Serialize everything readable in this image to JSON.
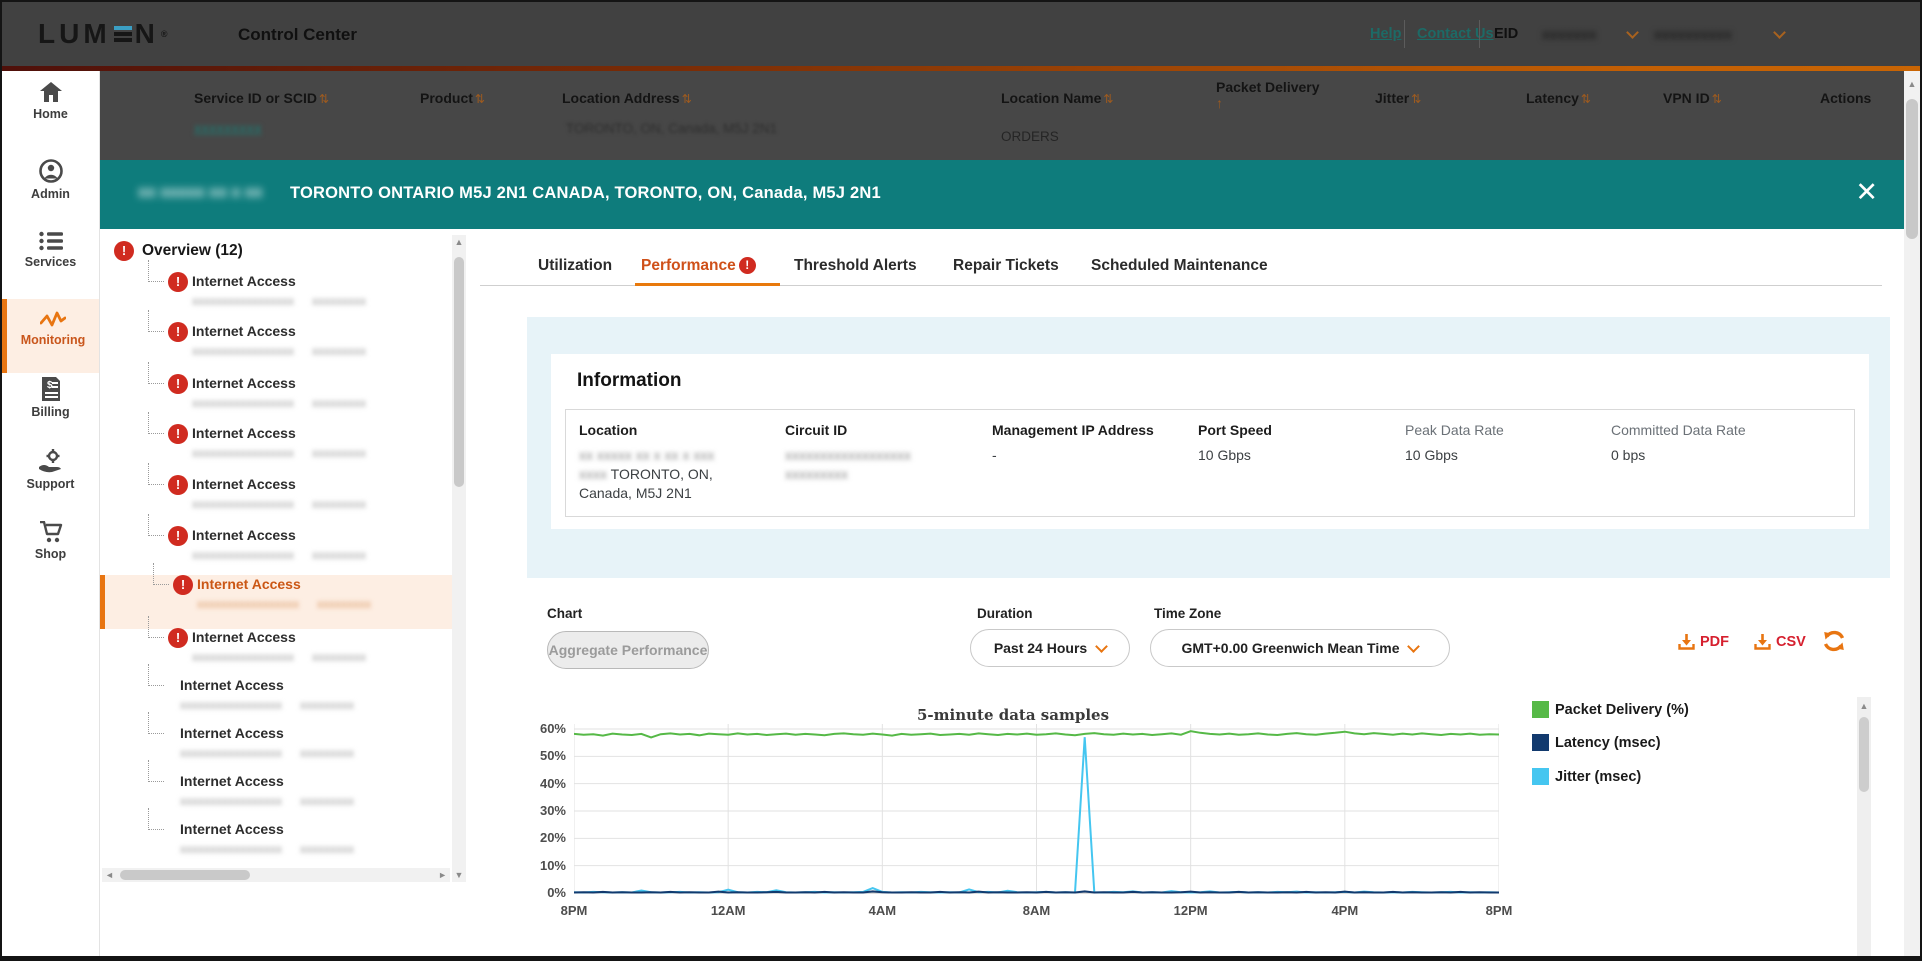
{
  "header": {
    "logo": "LUM·N",
    "logo_registered": "®",
    "app_title": "Control Center",
    "help_link": "Help",
    "contact_link": "Contact Us",
    "eid_label": "EID",
    "eid_value_masked": "xxxxxxx",
    "account_value_masked": "xxxxxxxxxx"
  },
  "table": {
    "columns": [
      {
        "label": "Service ID or SCID",
        "sort_glyph": "⇅"
      },
      {
        "label": "Product",
        "sort_glyph": "⇅"
      },
      {
        "label": "Location Address",
        "sort_glyph": "⇅"
      },
      {
        "label": "Location Name",
        "sort_glyph": "⇅"
      },
      {
        "label": "Packet Delivery",
        "sort_glyph": "↑"
      },
      {
        "label": "Jitter",
        "sort_glyph": "⇅"
      },
      {
        "label": "Latency",
        "sort_glyph": "⇅"
      },
      {
        "label": "VPN ID",
        "sort_glyph": "⇅"
      },
      {
        "label": "Actions",
        "sort_glyph": ""
      }
    ],
    "partial_row": {
      "service_id_masked": "xxxxxxxxx",
      "location_address_partial": "TORONTO, ON, Canada, M5J 2N1",
      "location_name": "ORDERS"
    }
  },
  "banner": {
    "masked_prefix": "xx xxxxx xx x xx",
    "address": "TORONTO ONTARIO M5J 2N1 CANADA, TORONTO, ON, Canada, M5J 2N1",
    "close_glyph": "✕"
  },
  "sidebar": {
    "items": [
      {
        "label": "Home"
      },
      {
        "label": "Admin"
      },
      {
        "label": "Services"
      },
      {
        "label": "Monitoring",
        "active": true
      },
      {
        "label": "Billing"
      },
      {
        "label": "Support"
      },
      {
        "label": "Shop"
      }
    ]
  },
  "tree": {
    "title": "Overview (12)",
    "kebab_glyph": "⋮",
    "items": [
      {
        "title": "Internet Access",
        "masked_id": "xxxxxxxxxxxxxxxxx",
        "masked_ref": "xxxxxxxxx"
      },
      {
        "title": "Internet Access",
        "masked_id": "xxxxxxxxxxxxxxxxx",
        "masked_ref": "xxxxxxxxx"
      },
      {
        "title": "Internet Access",
        "masked_id": "xxxxxxxxxxxxxxxxx",
        "masked_ref": "xxxxxxxxx"
      },
      {
        "title": "Internet Access",
        "masked_id": "xxxxxxxxxxxxxxxxx",
        "masked_ref": "xxxxxxxxx"
      },
      {
        "title": "Internet Access",
        "masked_id": "xxxxxxxxxxxxxxxxx",
        "masked_ref": "xxxxxxxxx"
      },
      {
        "title": "Internet Access",
        "masked_id": "xxxxxxxxxxxxxxxxx",
        "masked_ref": "xxxxxxxxx"
      },
      {
        "title": "Internet Access",
        "masked_id": "xxxxxxxxxxxxxxxxx",
        "masked_ref": "xxxxxxxxx"
      },
      {
        "title": "Internet Access",
        "masked_id": "xxxxxxxxxxxxxxxxx",
        "masked_ref": "xxxxxxxxx"
      },
      {
        "title": "Internet Access",
        "masked_id": "xxxxxxxxxxxxxxxxx",
        "masked_ref": "xxxxxxxxx"
      },
      {
        "title": "Internet Access",
        "masked_id": "xxxxxxxxxxxxxxxxx",
        "masked_ref": "xxxxxxxxx"
      },
      {
        "title": "Internet Access",
        "masked_id": "xxxxxxxxxxxxxxxxx",
        "masked_ref": "xxxxxxxxx"
      },
      {
        "title": "Internet Access",
        "masked_id": "xxxxxxxxxxxxxxxxx",
        "masked_ref": "xxxxxxxxx"
      }
    ]
  },
  "tabs": {
    "items": [
      {
        "label": "Utilization"
      },
      {
        "label": "Performance",
        "badge": "!"
      },
      {
        "label": "Threshold Alerts"
      },
      {
        "label": "Repair Tickets"
      },
      {
        "label": "Scheduled Maintenance"
      }
    ]
  },
  "information": {
    "heading": "Information",
    "location_label": "Location",
    "location_masked_line1": "xx xxxxx xx x xx x xxx",
    "location_masked_line2_prefix": "xxxx",
    "location_line2": "TORONTO, ON,",
    "location_line3": "Canada, M5J 2N1",
    "circuit_label": "Circuit ID",
    "circuit_masked_line1": "xxxxxxxxxxxxxxxxxx",
    "circuit_masked_line2": "xxxxxxxxx",
    "mgmt_label": "Management IP Address",
    "mgmt_value": "-",
    "port_label": "Port Speed",
    "port_value": "10 Gbps",
    "peak_label": "Peak Data Rate",
    "peak_value": "10 Gbps",
    "committed_label": "Committed Data Rate",
    "committed_value": "0 bps"
  },
  "chart_controls": {
    "chart_label": "Chart",
    "aggregate_button": "Aggregate Performance",
    "duration_label": "Duration",
    "duration_value": "Past 24 Hours",
    "timezone_label": "Time Zone",
    "timezone_value": "GMT+0.00 Greenwich Mean Time",
    "pdf_label": "PDF",
    "csv_label": "CSV"
  },
  "colors": {
    "teal_banner": "#0e7c7c",
    "brand_orange": "#e87511",
    "active_tab_orange": "#cf5019",
    "alert_red": "#d02b20",
    "download_red": "#d6202f",
    "packet_delivery_green": "#56b947",
    "latency_navy": "#123a6e",
    "jitter_cyan": "#45c6f0"
  },
  "chart_data": {
    "type": "line",
    "title": "5-minute data samples",
    "x_labels": [
      "8PM",
      "12AM",
      "4AM",
      "8AM",
      "12PM",
      "4PM",
      "8PM"
    ],
    "yticks": [
      0,
      10,
      20,
      30,
      40,
      50,
      60
    ],
    "ytick_suffix": "%",
    "ylim": [
      0,
      62
    ],
    "grid": true,
    "legend_position": "right",
    "series": [
      {
        "name": "Packet Delivery (%)",
        "color": "#56b947",
        "values": [
          58.2,
          57.9,
          58.1,
          57.6,
          58.3,
          58.0,
          57.8,
          58.2,
          56.9,
          58.1,
          58.4,
          58.0,
          58.2,
          57.7,
          58.3,
          58.1,
          57.9,
          58.4,
          58.0,
          58.2,
          57.8,
          58.1,
          58.3,
          57.9,
          58.2,
          58.0,
          57.7,
          58.2,
          58.4,
          58.1,
          57.9,
          58.3,
          58.0,
          57.6,
          58.2,
          57.9,
          58.1,
          58.3,
          57.8,
          58.0,
          58.2,
          57.9,
          58.4,
          58.1,
          57.8,
          58.2,
          58.0,
          58.3,
          57.9,
          58.1,
          58.4,
          58.0,
          57.7,
          58.2,
          58.5,
          58.1,
          57.9,
          58.3,
          58.0,
          58.2,
          57.8,
          58.1,
          58.4,
          57.9,
          59.2,
          58.6,
          58.2,
          58.0,
          58.3,
          57.9,
          58.1,
          58.4,
          58.0,
          57.8,
          58.2,
          58.5,
          58.1,
          57.9,
          58.3,
          58.6,
          59.0,
          58.4,
          58.1,
          58.5,
          58.2,
          57.9,
          58.3,
          58.0,
          58.4,
          58.1,
          57.8,
          58.2,
          58.0,
          58.3,
          57.9,
          58.1,
          58.0
        ]
      },
      {
        "name": "Latency (msec)",
        "color": "#123a6e",
        "values": [
          0.2,
          0.3,
          0.2,
          0.4,
          0.2,
          0.3,
          0.2,
          0.2,
          0.3,
          0.2,
          0.4,
          0.2,
          0.3,
          0.2,
          0.2,
          0.5,
          0.2,
          0.3,
          0.2,
          0.2,
          0.3,
          0.4,
          0.2,
          0.2,
          0.3,
          0.2,
          0.4,
          0.2,
          0.3,
          0.2,
          0.2,
          0.6,
          0.3,
          0.2,
          0.2,
          0.3,
          0.2,
          0.2,
          0.4,
          0.2,
          0.3,
          0.2,
          0.5,
          0.2,
          0.3,
          0.2,
          0.2,
          0.3,
          0.2,
          0.4,
          0.2,
          0.3,
          0.2,
          0.6,
          0.2,
          0.3,
          0.2,
          0.2,
          0.4,
          0.2,
          0.3,
          0.2,
          0.2,
          0.3,
          0.5,
          0.2,
          0.3,
          0.2,
          0.2,
          0.4,
          0.2,
          0.3,
          0.2,
          0.2,
          0.3,
          0.2,
          0.4,
          0.2,
          0.3,
          0.2,
          0.5,
          0.2,
          0.3,
          0.2,
          0.2,
          0.4,
          0.2,
          0.3,
          0.2,
          0.2,
          0.3,
          0.2,
          0.4,
          0.2,
          0.3,
          0.2,
          0.2
        ]
      },
      {
        "name": "Jitter (msec)",
        "color": "#45c6f0",
        "values": [
          0.3,
          0.2,
          0.4,
          0.3,
          0.2,
          0.3,
          0.2,
          0.9,
          0.3,
          0.2,
          0.3,
          0.4,
          0.2,
          0.3,
          0.2,
          0.3,
          1.2,
          0.3,
          0.2,
          0.4,
          0.3,
          1.0,
          0.3,
          0.2,
          0.3,
          0.4,
          0.2,
          0.3,
          0.2,
          0.3,
          0.4,
          1.8,
          0.4,
          0.2,
          0.3,
          0.2,
          0.4,
          0.3,
          0.2,
          0.3,
          0.2,
          1.3,
          0.3,
          0.4,
          0.2,
          0.8,
          0.3,
          0.2,
          0.3,
          0.4,
          0.2,
          0.3,
          0.2,
          57.0,
          0.3,
          0.2,
          0.4,
          0.3,
          0.6,
          0.2,
          0.3,
          0.2,
          0.7,
          0.3,
          0.2,
          0.3,
          0.6,
          0.2,
          0.3,
          0.4,
          0.2,
          0.3,
          0.2,
          0.4,
          0.3,
          0.5,
          0.2,
          0.3,
          0.2,
          0.3,
          0.4,
          0.2,
          0.5,
          0.3,
          0.2,
          0.3,
          0.2,
          0.4,
          0.3,
          0.2,
          0.3,
          0.4,
          0.2,
          0.3,
          0.2,
          0.3,
          0.2
        ]
      }
    ]
  }
}
